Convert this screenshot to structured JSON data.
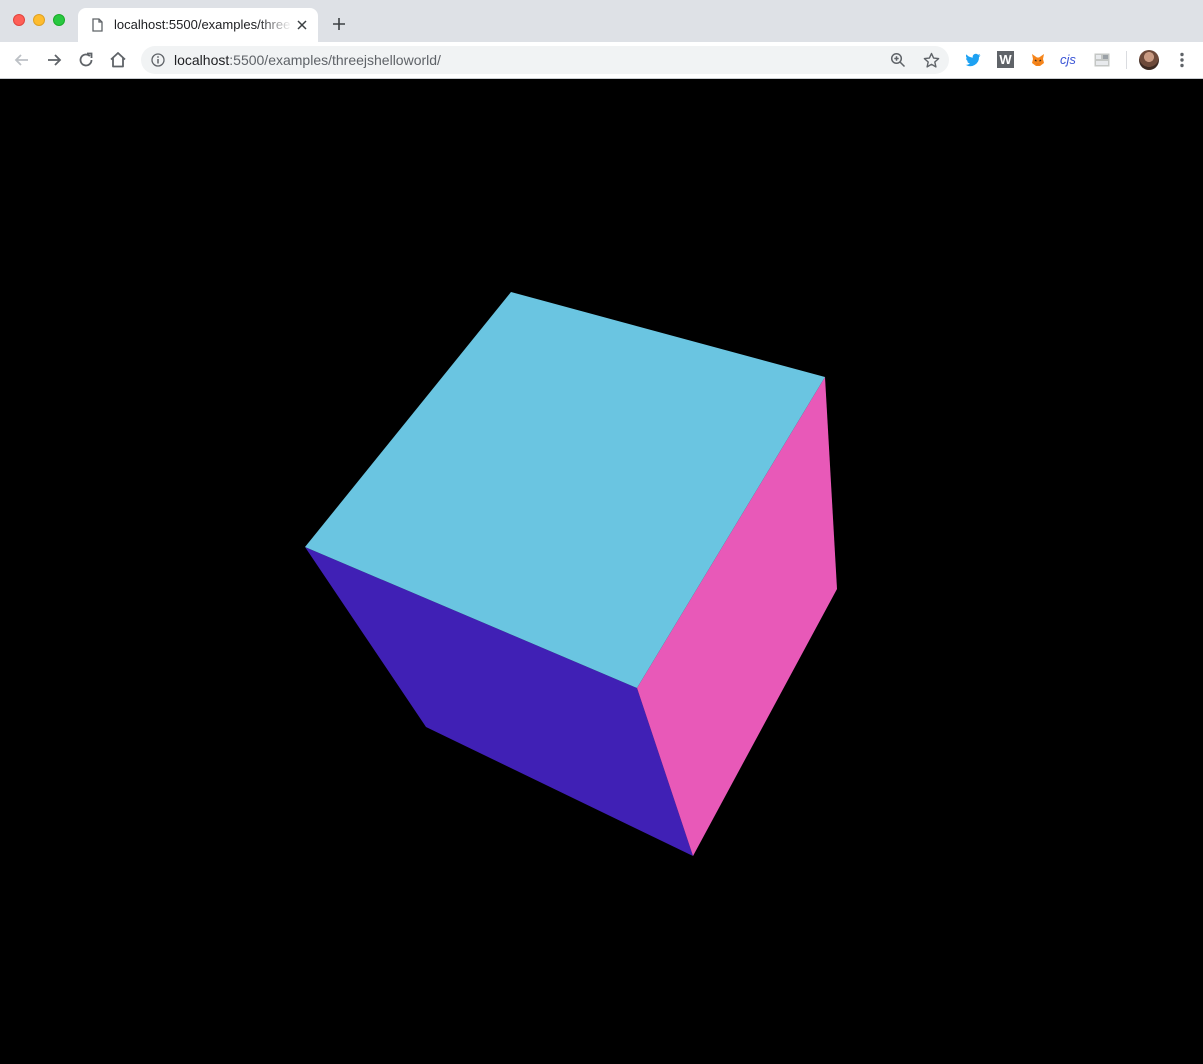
{
  "browser": {
    "tab": {
      "title": "localhost:5500/examples/threejshelloworld/",
      "favicon": "page-icon"
    },
    "new_tab_icon": "plus-icon",
    "nav": {
      "back_icon": "back-arrow-icon",
      "forward_icon": "forward-arrow-icon",
      "reload_icon": "reload-icon",
      "home_icon": "home-icon"
    },
    "omnibox": {
      "host": "localhost",
      "path": ":5500/examples/threejshelloworld/",
      "info_icon": "info-icon",
      "zoom_icon": "zoom-in-icon",
      "bookmark_icon": "star-icon"
    },
    "extensions": [
      {
        "name": "twitter-icon",
        "color": "#1da1f2"
      },
      {
        "name": "w-icon",
        "label": "W"
      },
      {
        "name": "metamask-fox-icon",
        "color": "#f6851b"
      },
      {
        "name": "cjs-icon",
        "label": "cjs"
      },
      {
        "name": "extension-grid-icon"
      }
    ],
    "menu_icon": "more-vertical-icon"
  },
  "scene": {
    "description_type": "webgl-cube",
    "background": "#000000",
    "faces": {
      "top": "#6ac5e1",
      "right": "#e859b8",
      "front": "#4020b5"
    }
  }
}
